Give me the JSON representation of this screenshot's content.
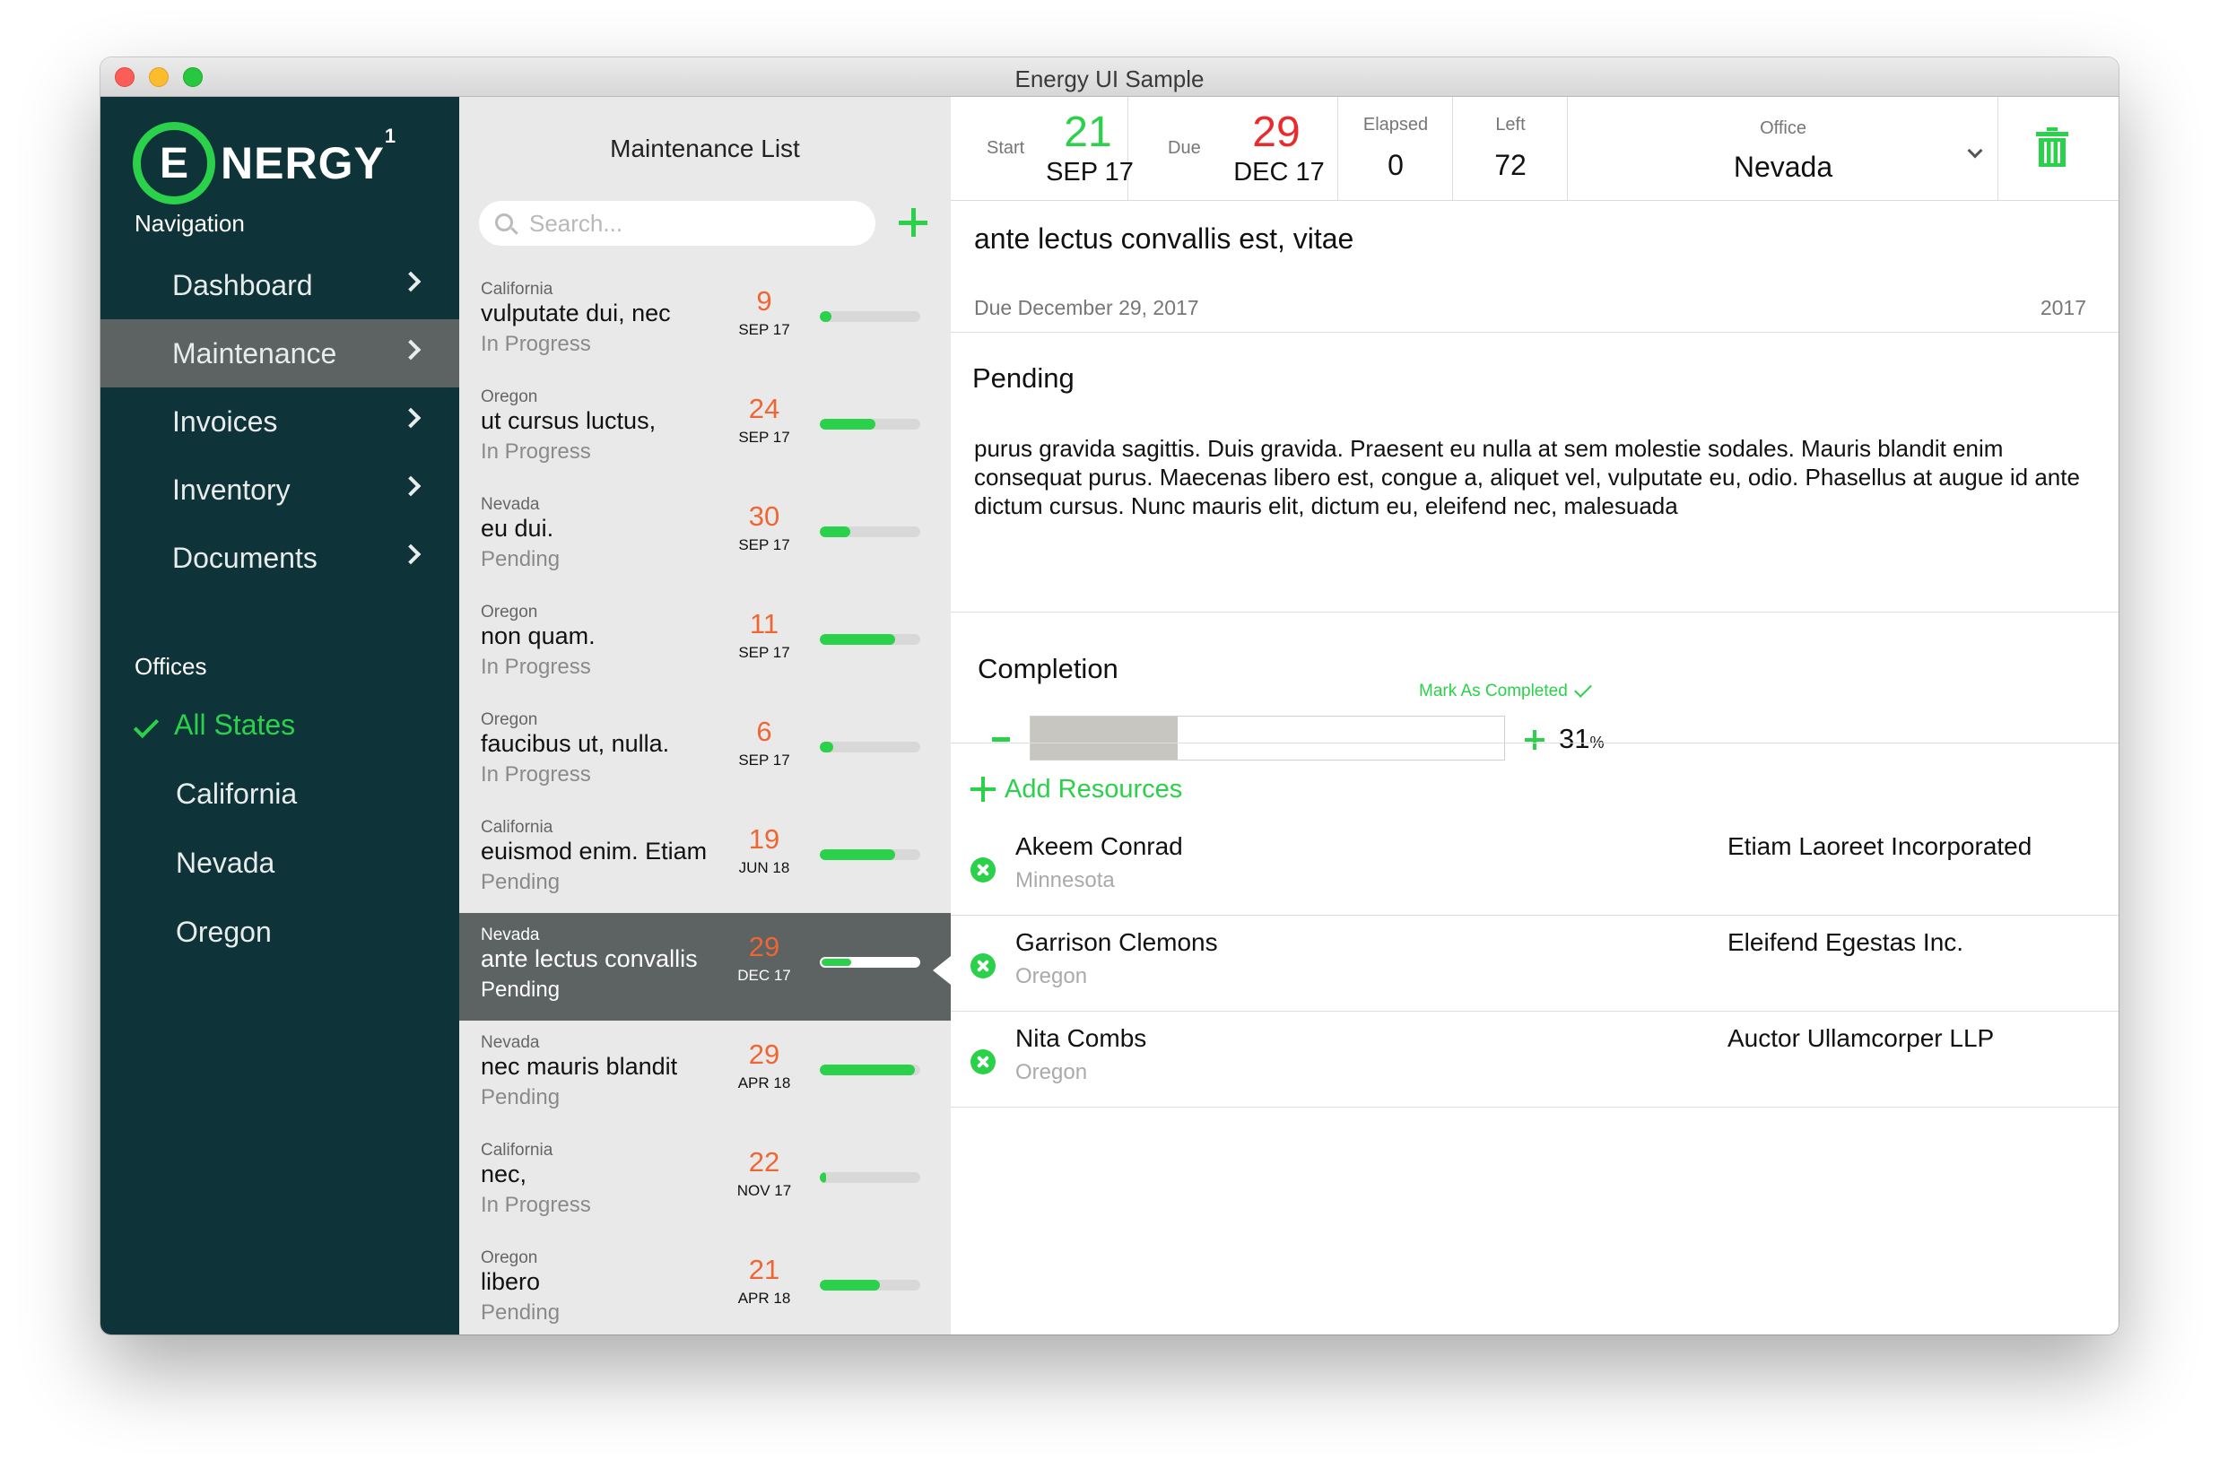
{
  "window": {
    "title": "Energy UI Sample"
  },
  "brand": {
    "mark": "E",
    "text": "NERGY",
    "sup": "1"
  },
  "sidebar": {
    "nav_title": "Navigation",
    "nav": [
      {
        "label": "Dashboard"
      },
      {
        "label": "Maintenance",
        "active": true
      },
      {
        "label": "Invoices"
      },
      {
        "label": "Inventory"
      },
      {
        "label": "Documents"
      }
    ],
    "offices_title": "Offices",
    "offices": [
      {
        "label": "All States",
        "selected": true
      },
      {
        "label": "California"
      },
      {
        "label": "Nevada"
      },
      {
        "label": "Oregon"
      }
    ]
  },
  "list": {
    "title": "Maintenance List",
    "search_placeholder": "Search...",
    "rows": [
      {
        "state": "California",
        "name": "vulputate dui, nec",
        "status": "In Progress",
        "day": "9",
        "month": "SEP 17",
        "progress": 0.12
      },
      {
        "state": "Oregon",
        "name": "ut cursus luctus,",
        "status": "In Progress",
        "day": "24",
        "month": "SEP 17",
        "progress": 0.55
      },
      {
        "state": "Nevada",
        "name": "eu dui.",
        "status": "Pending",
        "day": "30",
        "month": "SEP 17",
        "progress": 0.3
      },
      {
        "state": "Oregon",
        "name": "non quam.",
        "status": "In Progress",
        "day": "11",
        "month": "SEP 17",
        "progress": 0.75
      },
      {
        "state": "Oregon",
        "name": "faucibus ut, nulla.",
        "status": "In Progress",
        "day": "6",
        "month": "SEP 17",
        "progress": 0.13
      },
      {
        "state": "California",
        "name": "euismod enim. Etiam",
        "status": "Pending",
        "day": "19",
        "month": "JUN 18",
        "progress": 0.75
      },
      {
        "state": "Nevada",
        "name": "ante lectus convallis",
        "status": "Pending",
        "day": "29",
        "month": "DEC 17",
        "progress": 0.31,
        "selected": true
      },
      {
        "state": "Nevada",
        "name": "nec mauris blandit",
        "status": "Pending",
        "day": "29",
        "month": "APR 18",
        "progress": 0.95
      },
      {
        "state": "California",
        "name": "nec,",
        "status": "In Progress",
        "day": "22",
        "month": "NOV 17",
        "progress": 0.06
      },
      {
        "state": "Oregon",
        "name": "libero",
        "status": "Pending",
        "day": "21",
        "month": "APR 18",
        "progress": 0.6
      }
    ]
  },
  "detail": {
    "start": {
      "label": "Start",
      "day": "21",
      "month": "SEP 17",
      "color": "#2bd14a"
    },
    "due": {
      "label": "Due",
      "day": "29",
      "month": "DEC 17",
      "color": "#ea2b2b"
    },
    "elapsed": {
      "label": "Elapsed",
      "value": "0"
    },
    "left": {
      "label": "Left",
      "value": "72"
    },
    "office": {
      "label": "Office",
      "value": "Nevada"
    },
    "title": "ante lectus convallis est, vitae",
    "due_text": "Due December 29, 2017",
    "year": "2017",
    "status": "Pending",
    "description": "purus gravida sagittis. Duis gravida. Praesent eu nulla at sem molestie sodales. Mauris blandit enim consequat purus. Maecenas libero est, congue a, aliquet vel, vulputate eu, odio. Phasellus at augue id ante dictum cursus. Nunc mauris elit, dictum eu, eleifend nec, malesuada",
    "completion": {
      "title": "Completion",
      "mark_label": "Mark As Completed",
      "percent": 31,
      "percent_text": "31",
      "percent_sign": "%"
    },
    "add_resources_label": "Add Resources",
    "resources": [
      {
        "name": "Akeem Conrad",
        "state": "Minnesota",
        "company": "Etiam Laoreet Incorporated"
      },
      {
        "name": "Garrison Clemons",
        "state": "Oregon",
        "company": "Eleifend Egestas Inc."
      },
      {
        "name": "Nita Combs",
        "state": "Oregon",
        "company": "Auctor Ullamcorper LLP"
      }
    ]
  },
  "colors": {
    "accent": "#2bd14a",
    "sidebar": "#0e3338",
    "selected": "#5d6263",
    "date_orange": "#ee6634",
    "due_red": "#ea2b2b"
  }
}
